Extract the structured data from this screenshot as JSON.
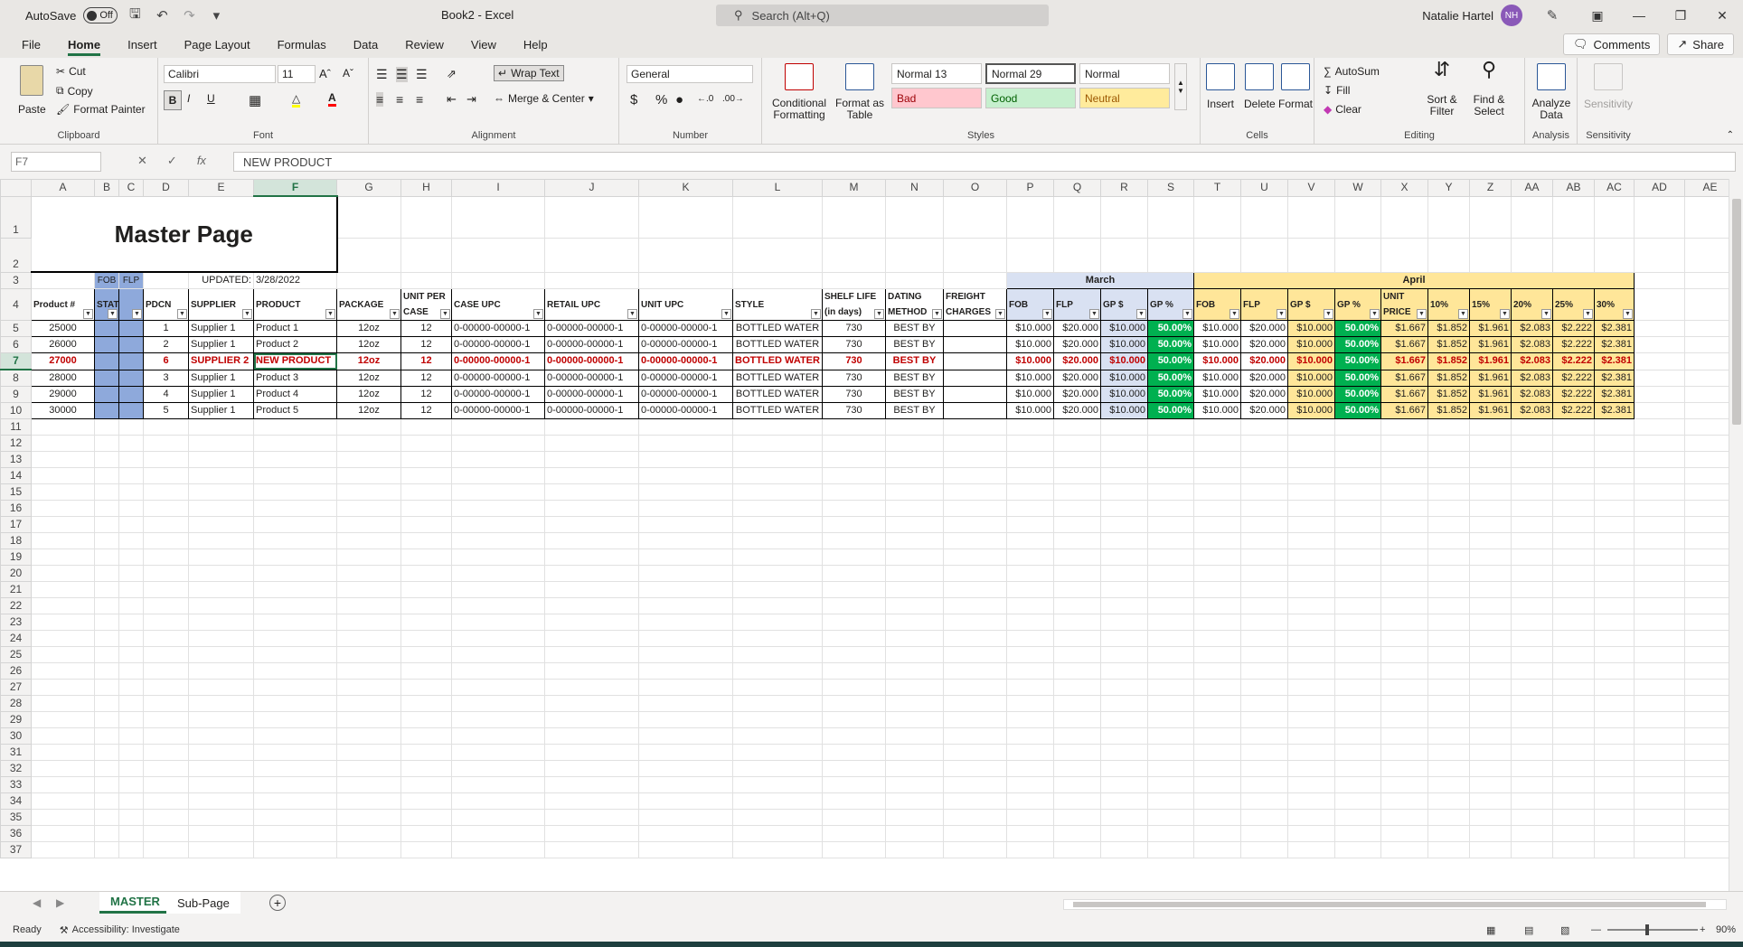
{
  "titlebar": {
    "autosave_label": "AutoSave",
    "autosave_state": "Off",
    "doc_title": "Book2 - Excel",
    "search_placeholder": "Search (Alt+Q)",
    "user_name": "Natalie Hartel",
    "user_initials": "NH"
  },
  "menu": {
    "tabs": [
      "File",
      "Home",
      "Insert",
      "Page Layout",
      "Formulas",
      "Data",
      "Review",
      "View",
      "Help"
    ],
    "active": "Home",
    "comments_label": "Comments",
    "share_label": "Share"
  },
  "ribbon": {
    "clipboard": {
      "paste": "Paste",
      "cut": "Cut",
      "copy": "Copy",
      "format_painter": "Format Painter",
      "label": "Clipboard"
    },
    "font": {
      "family": "Calibri",
      "size": "11",
      "bold": "B",
      "italic": "I",
      "underline": "U",
      "label": "Font"
    },
    "alignment": {
      "wrap_text": "Wrap Text",
      "merge_center": "Merge & Center",
      "label": "Alignment"
    },
    "number": {
      "format": "General",
      "label": "Number"
    },
    "styles": {
      "cond_format": "Conditional Formatting",
      "format_table": "Format as Table",
      "normal13": "Normal 13",
      "normal29": "Normal 29",
      "normal": "Normal",
      "bad": "Bad",
      "good": "Good",
      "neutral": "Neutral",
      "label": "Styles"
    },
    "cells": {
      "insert": "Insert",
      "delete": "Delete",
      "format": "Format",
      "label": "Cells"
    },
    "editing": {
      "autosum": "AutoSum",
      "fill": "Fill",
      "clear": "Clear",
      "sort_filter": "Sort & Filter",
      "find_select": "Find & Select",
      "label": "Editing"
    },
    "analysis": {
      "analyze_data": "Analyze Data",
      "label": "Analysis"
    },
    "sensitivity": {
      "btn": "Sensitivity",
      "label": "Sensitivity"
    }
  },
  "formula": {
    "namebox": "F7",
    "content": "NEW PRODUCT"
  },
  "columns": [
    "A",
    "B",
    "C",
    "D",
    "E",
    "F",
    "G",
    "H",
    "I",
    "J",
    "K",
    "L",
    "M",
    "N",
    "O",
    "P",
    "Q",
    "R",
    "S",
    "T",
    "U",
    "V",
    "W",
    "X",
    "Y",
    "Z",
    "AA",
    "AB",
    "AC",
    "AD",
    "AE"
  ],
  "sheet": {
    "title": "Master Page",
    "updated_label": "UPDATED:",
    "updated_value": "3/28/2022",
    "fob_tag": "FOB",
    "flp_tag": "FLP",
    "march": "March",
    "april": "April",
    "headers": [
      "Product #",
      "STATUS",
      "",
      "PDCN",
      "SUPPLIER",
      "PRODUCT",
      "PACKAGE",
      "UNIT PER CASE",
      "CASE UPC",
      "RETAIL UPC",
      "UNIT UPC",
      "STYLE",
      "SHELF LIFE (in days)",
      "DATING METHOD",
      "FREIGHT CHARGES",
      "FOB",
      "FLP",
      "GP $",
      "GP %",
      "FOB",
      "FLP",
      "GP $",
      "GP %",
      "UNIT PRICE",
      "10%",
      "15%",
      "20%",
      "25%",
      "30%"
    ],
    "rows": [
      {
        "product_no": "25000",
        "pdcn": "1",
        "supplier": "Supplier 1",
        "product": "Product 1",
        "package": "12oz",
        "upc": "12",
        "case_upc": "0-00000-00000-1",
        "retail_upc": "0-00000-00000-1",
        "unit_upc": "0-00000-00000-1",
        "style": "BOTTLED WATER",
        "shelf": "730",
        "dating": "BEST BY",
        "fob": "$10.000",
        "flp": "$20.000",
        "gpd": "$10.000",
        "gpp": "50.00%",
        "unit": "$1.667",
        "p10": "$1.852",
        "p15": "$1.961",
        "p20": "$2.083",
        "p25": "$2.222",
        "p30": "$2.381",
        "highlight": false
      },
      {
        "product_no": "26000",
        "pdcn": "2",
        "supplier": "Supplier 1",
        "product": "Product 2",
        "package": "12oz",
        "upc": "12",
        "case_upc": "0-00000-00000-1",
        "retail_upc": "0-00000-00000-1",
        "unit_upc": "0-00000-00000-1",
        "style": "BOTTLED WATER",
        "shelf": "730",
        "dating": "BEST BY",
        "fob": "$10.000",
        "flp": "$20.000",
        "gpd": "$10.000",
        "gpp": "50.00%",
        "unit": "$1.667",
        "p10": "$1.852",
        "p15": "$1.961",
        "p20": "$2.083",
        "p25": "$2.222",
        "p30": "$2.381",
        "highlight": false
      },
      {
        "product_no": "27000",
        "pdcn": "6",
        "supplier": "SUPPLIER 2",
        "product": "NEW PRODUCT",
        "package": "12oz",
        "upc": "12",
        "case_upc": "0-00000-00000-1",
        "retail_upc": "0-00000-00000-1",
        "unit_upc": "0-00000-00000-1",
        "style": "BOTTLED WATER",
        "shelf": "730",
        "dating": "BEST BY",
        "fob": "$10.000",
        "flp": "$20.000",
        "gpd": "$10.000",
        "gpp": "50.00%",
        "unit": "$1.667",
        "p10": "$1.852",
        "p15": "$1.961",
        "p20": "$2.083",
        "p25": "$2.222",
        "p30": "$2.381",
        "highlight": true
      },
      {
        "product_no": "28000",
        "pdcn": "3",
        "supplier": "Supplier 1",
        "product": "Product 3",
        "package": "12oz",
        "upc": "12",
        "case_upc": "0-00000-00000-1",
        "retail_upc": "0-00000-00000-1",
        "unit_upc": "0-00000-00000-1",
        "style": "BOTTLED WATER",
        "shelf": "730",
        "dating": "BEST BY",
        "fob": "$10.000",
        "flp": "$20.000",
        "gpd": "$10.000",
        "gpp": "50.00%",
        "unit": "$1.667",
        "p10": "$1.852",
        "p15": "$1.961",
        "p20": "$2.083",
        "p25": "$2.222",
        "p30": "$2.381",
        "highlight": false
      },
      {
        "product_no": "29000",
        "pdcn": "4",
        "supplier": "Supplier 1",
        "product": "Product 4",
        "package": "12oz",
        "upc": "12",
        "case_upc": "0-00000-00000-1",
        "retail_upc": "0-00000-00000-1",
        "unit_upc": "0-00000-00000-1",
        "style": "BOTTLED WATER",
        "shelf": "730",
        "dating": "BEST BY",
        "fob": "$10.000",
        "flp": "$20.000",
        "gpd": "$10.000",
        "gpp": "50.00%",
        "unit": "$1.667",
        "p10": "$1.852",
        "p15": "$1.961",
        "p20": "$2.083",
        "p25": "$2.222",
        "p30": "$2.381",
        "highlight": false
      },
      {
        "product_no": "30000",
        "pdcn": "5",
        "supplier": "Supplier 1",
        "product": "Product 5",
        "package": "12oz",
        "upc": "12",
        "case_upc": "0-00000-00000-1",
        "retail_upc": "0-00000-00000-1",
        "unit_upc": "0-00000-00000-1",
        "style": "BOTTLED WATER",
        "shelf": "730",
        "dating": "BEST BY",
        "fob": "$10.000",
        "flp": "$20.000",
        "gpd": "$10.000",
        "gpp": "50.00%",
        "unit": "$1.667",
        "p10": "$1.852",
        "p15": "$1.961",
        "p20": "$2.083",
        "p25": "$2.222",
        "p30": "$2.381",
        "highlight": false
      }
    ]
  },
  "tabs": [
    "MASTER",
    "Sub-Page"
  ],
  "status": {
    "ready": "Ready",
    "accessibility": "Accessibility: Investigate",
    "zoom": "90%"
  }
}
